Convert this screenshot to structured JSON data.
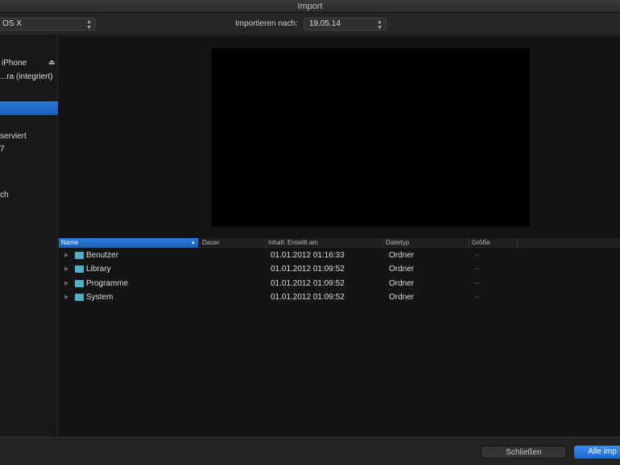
{
  "window": {
    "title": "Import"
  },
  "toolbar": {
    "source_value": "OS X",
    "import_to_label": "Importieren nach:",
    "import_to_value": "19.05.14"
  },
  "sidebar": {
    "items": [
      {
        "label": "iPhone"
      },
      {
        "label": "...ra (integriert)"
      },
      {
        "label": ""
      },
      {
        "label": "serviert"
      },
      {
        "label": "7"
      },
      {
        "label": "ch"
      }
    ]
  },
  "table": {
    "columns": [
      "Name",
      "Dauer",
      "Inhalt: Erstellt am",
      "Dateityp",
      "Größe"
    ],
    "rows": [
      {
        "name": "Benutzer",
        "duration": "",
        "created": "01.01.2012 01:16:33",
        "type": "Ordner",
        "size": "--"
      },
      {
        "name": "Library",
        "duration": "",
        "created": "01.01.2012 01:09:52",
        "type": "Ordner",
        "size": "--"
      },
      {
        "name": "Programme",
        "duration": "",
        "created": "01.01.2012 01:09:52",
        "type": "Ordner",
        "size": "--"
      },
      {
        "name": "System",
        "duration": "",
        "created": "01.01.2012 01:09:52",
        "type": "Ordner",
        "size": "--"
      }
    ]
  },
  "buttons": {
    "close": "Schließen",
    "import_all": "Alle imp"
  }
}
